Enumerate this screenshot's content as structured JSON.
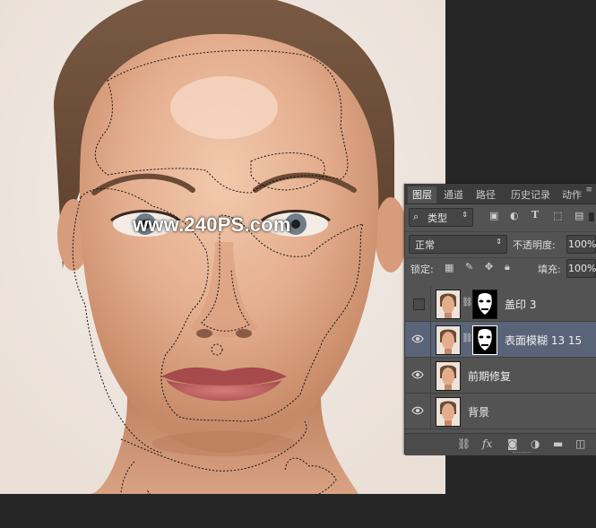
{
  "watermark": "www.240PS.com",
  "panel": {
    "tabs": [
      {
        "label": "图层",
        "active": true
      },
      {
        "label": "通道",
        "active": false
      },
      {
        "label": "路径",
        "active": false
      },
      {
        "label": "历史记录",
        "active": false
      },
      {
        "label": "动作",
        "active": false
      }
    ],
    "filter": {
      "label": "类型",
      "icons": [
        "image-filter-icon",
        "adjustment-filter-icon",
        "type-filter-icon",
        "shape-filter-icon",
        "smart-object-filter-icon"
      ]
    },
    "blend_mode": "正常",
    "opacity_label": "不透明度:",
    "opacity_value": "100%",
    "lock_label": "锁定:",
    "fill_label": "填充:",
    "fill_value": "100%",
    "layers": [
      {
        "name": "盖印 3",
        "visible": false,
        "has_mask": true,
        "selected": false
      },
      {
        "name": "表面模糊 13 15",
        "visible": true,
        "has_mask": true,
        "selected": true
      },
      {
        "name": "前期修复",
        "visible": true,
        "has_mask": false,
        "selected": false
      },
      {
        "name": "背景",
        "visible": true,
        "has_mask": false,
        "selected": false
      }
    ],
    "footer_icons": [
      "link-icon",
      "fx-icon",
      "mask-icon",
      "adjustment-icon",
      "folder-icon",
      "new-layer-icon"
    ]
  },
  "colors": {
    "panel_bg": "#535353",
    "selected_layer": "#5a6478",
    "workspace": "#262626"
  }
}
